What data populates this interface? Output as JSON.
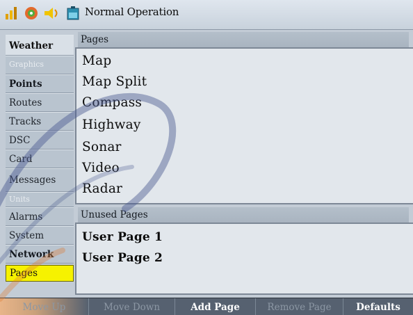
{
  "titlebar": {
    "title": "Normal Operation",
    "icons": [
      "gps-signal-icon",
      "target-icon",
      "speaker-icon",
      "battery-icon"
    ]
  },
  "sidebar": {
    "items": [
      {
        "label": "Weather",
        "state": "active-tab"
      },
      {
        "label": "Graphics",
        "state": "dim"
      },
      {
        "label": "Points",
        "state": "bold"
      },
      {
        "label": "Routes",
        "state": "normal"
      },
      {
        "label": "Tracks",
        "state": "normal"
      },
      {
        "label": "DSC",
        "state": "normal"
      },
      {
        "label": "Card",
        "state": "normal"
      },
      {
        "label": "Messages",
        "state": "normal"
      },
      {
        "label": "Units",
        "state": "dim"
      },
      {
        "label": "Alarms",
        "state": "normal"
      },
      {
        "label": "System",
        "state": "normal"
      },
      {
        "label": "Network",
        "state": "bold"
      },
      {
        "label": "Pages",
        "state": "selected"
      }
    ]
  },
  "pages_group": {
    "label": "Pages",
    "items": [
      "Map",
      "Map Split",
      "Compass",
      "Highway",
      "Sonar",
      "Video",
      "Radar"
    ]
  },
  "unused_group": {
    "label": "Unused Pages",
    "items": [
      "User Page 1",
      "User Page 2"
    ]
  },
  "softkeys": [
    {
      "label": "Move Up",
      "enabled": false
    },
    {
      "label": "Move Down",
      "enabled": false
    },
    {
      "label": "Add Page",
      "enabled": true
    },
    {
      "label": "Remove Page",
      "enabled": false
    },
    {
      "label": "Defaults",
      "enabled": true
    }
  ],
  "colors": {
    "selection": "#f6f200",
    "background": "#c3ccd6",
    "softkey_bar": "#566170",
    "watermark": "#4a5890"
  }
}
